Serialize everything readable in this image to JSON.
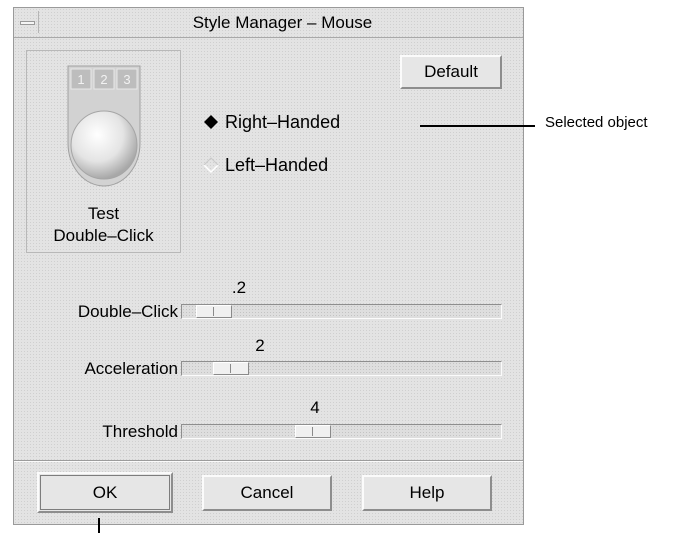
{
  "window": {
    "title": "Style Manager – Mouse",
    "menu_icon": "window-menu-icon"
  },
  "test_area": {
    "button_numbers": [
      "1",
      "2",
      "3"
    ],
    "label_line1": "Test",
    "label_line2": "Double–Click",
    "icon": "mouse-icon"
  },
  "default_button": {
    "label": "Default"
  },
  "handedness": {
    "options": [
      {
        "label": "Right–Handed",
        "selected": true
      },
      {
        "label": "Left–Handed",
        "selected": false
      }
    ]
  },
  "scales": {
    "double_click": {
      "label": "Double–Click",
      "value": ".2",
      "fraction": 0.05
    },
    "acceleration": {
      "label": "Acceleration",
      "value": "2",
      "fraction": 0.11
    },
    "threshold": {
      "label": "Threshold",
      "value": "4",
      "fraction": 0.4
    }
  },
  "actions": {
    "ok": "OK",
    "cancel": "Cancel",
    "help": "Help"
  },
  "annotation": {
    "callout": "Selected object"
  },
  "colors": {
    "window_bg": "#e3e3e3",
    "trough_bg": "#dedede"
  }
}
